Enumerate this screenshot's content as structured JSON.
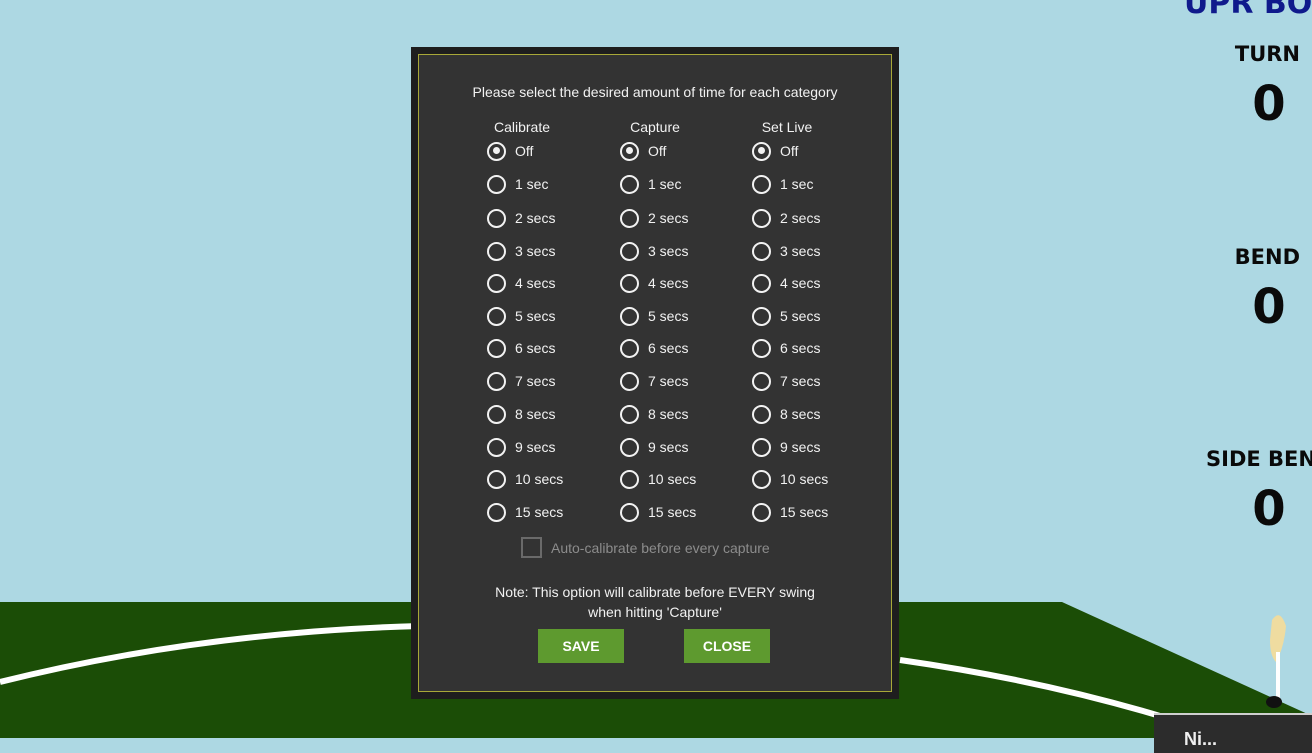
{
  "scene": {
    "brand_partial": "UPR BO",
    "stats": [
      {
        "label": "TURN",
        "value": "0"
      },
      {
        "label": "BEND",
        "value": "0"
      },
      {
        "label": "SIDE BEN",
        "value": "0"
      }
    ],
    "corner_panel_text": "Ni..."
  },
  "dialog": {
    "prompt": "Please select the desired amount of time for each category",
    "columns": [
      {
        "header": "Calibrate",
        "selected": "Off"
      },
      {
        "header": "Capture",
        "selected": "Off"
      },
      {
        "header": "Set Live",
        "selected": "Off"
      }
    ],
    "options": [
      "Off",
      "1 sec",
      "2 secs",
      "3 secs",
      "4 secs",
      "5 secs",
      "6 secs",
      "7 secs",
      "8 secs",
      "9 secs",
      "10 secs",
      "15 secs"
    ],
    "auto_calibrate": {
      "label": "Auto-calibrate before every capture",
      "checked": false,
      "enabled": false
    },
    "note_line1": "Note: This option will calibrate before EVERY swing",
    "note_line2": "when hitting 'Capture'",
    "save_label": "SAVE",
    "close_label": "CLOSE"
  },
  "colors": {
    "sky": "#add8e3",
    "grass": "#1b4d06",
    "dialog_bg": "#333333",
    "dialog_border": "#a8a838",
    "button_green": "#5e9a2f",
    "brand_blue": "#0f1a8c"
  }
}
